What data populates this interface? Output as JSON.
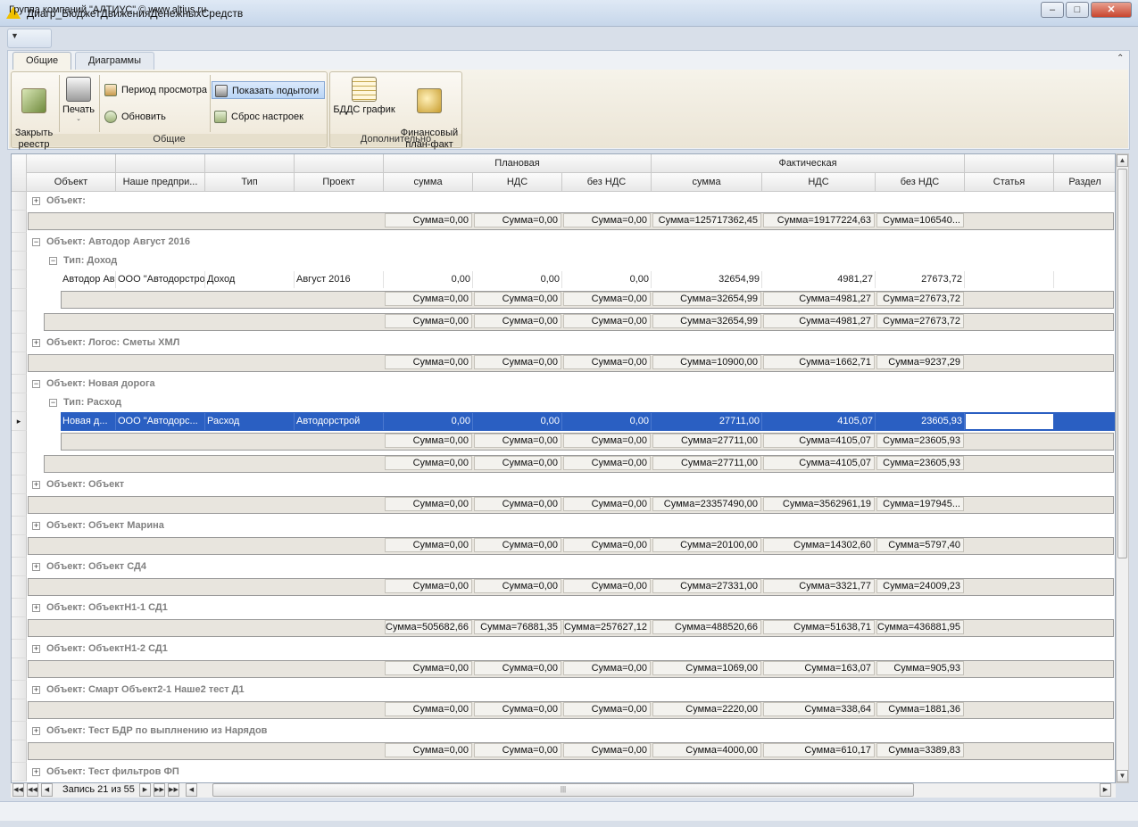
{
  "window": {
    "title": "Диагр_БюджетДвиженияДенежныхСредств"
  },
  "ribbon": {
    "tabs": [
      "Общие",
      "Диаграммы"
    ],
    "groups": {
      "general": {
        "label": "Общие",
        "close": "Закрыть\nреестр",
        "print": "Печать",
        "period": "Период просмотра",
        "refresh": "Обновить",
        "subtotals": "Показать подытоги",
        "reset": "Сброс настроек"
      },
      "extra": {
        "label": "Дополнительно",
        "bdds": "БДДС график",
        "finplan": "Финансовый\nплан-факт"
      }
    }
  },
  "grid": {
    "bands": {
      "planned": "Плановая",
      "actual": "Фактическая"
    },
    "columns": [
      "Объект",
      "Наше предпри...",
      "Тип",
      "Проект",
      "сумма",
      "НДС",
      "без НДС",
      "сумма",
      "НДС",
      "без НДС",
      "Статья",
      "Раздел"
    ],
    "rows": [
      {
        "kind": "group",
        "level": 0,
        "expanded": false,
        "text": "Объект:"
      },
      {
        "kind": "sum",
        "level": 0,
        "values": [
          "Сумма=0,00",
          "Сумма=0,00",
          "Сумма=0,00",
          "Сумма=125717362,45",
          "Сумма=19177224,63",
          "Сумма=106540..."
        ]
      },
      {
        "kind": "group",
        "level": 0,
        "expanded": true,
        "text": "Объект: Автодор Август 2016"
      },
      {
        "kind": "group",
        "level": 1,
        "expanded": true,
        "text": "Тип: Доход"
      },
      {
        "kind": "data",
        "selected": false,
        "cells": [
          "Автодор Ав",
          "ООО \"Автодорстро",
          "Доход",
          "Август 2016",
          "0,00",
          "0,00",
          "0,00",
          "32654,99",
          "4981,27",
          "27673,72",
          "",
          ""
        ]
      },
      {
        "kind": "sum",
        "level": 2,
        "values": [
          "Сумма=0,00",
          "Сумма=0,00",
          "Сумма=0,00",
          "Сумма=32654,99",
          "Сумма=4981,27",
          "Сумма=27673,72"
        ]
      },
      {
        "kind": "sum",
        "level": 1,
        "values": [
          "Сумма=0,00",
          "Сумма=0,00",
          "Сумма=0,00",
          "Сумма=32654,99",
          "Сумма=4981,27",
          "Сумма=27673,72"
        ]
      },
      {
        "kind": "group",
        "level": 0,
        "expanded": false,
        "text": "Объект: Логос: Сметы ХМЛ"
      },
      {
        "kind": "sum",
        "level": 0,
        "values": [
          "Сумма=0,00",
          "Сумма=0,00",
          "Сумма=0,00",
          "Сумма=10900,00",
          "Сумма=1662,71",
          "Сумма=9237,29"
        ]
      },
      {
        "kind": "group",
        "level": 0,
        "expanded": true,
        "text": "Объект: Новая дорога"
      },
      {
        "kind": "group",
        "level": 1,
        "expanded": true,
        "text": "Тип: Расход"
      },
      {
        "kind": "data",
        "selected": true,
        "cells": [
          "Новая д...",
          "ООО \"Автодорс...",
          "Расход",
          "Автодорстрой",
          "0,00",
          "0,00",
          "0,00",
          "27711,00",
          "4105,07",
          "23605,93",
          "",
          ""
        ]
      },
      {
        "kind": "sum",
        "level": 2,
        "values": [
          "Сумма=0,00",
          "Сумма=0,00",
          "Сумма=0,00",
          "Сумма=27711,00",
          "Сумма=4105,07",
          "Сумма=23605,93"
        ]
      },
      {
        "kind": "sum",
        "level": 1,
        "values": [
          "Сумма=0,00",
          "Сумма=0,00",
          "Сумма=0,00",
          "Сумма=27711,00",
          "Сумма=4105,07",
          "Сумма=23605,93"
        ]
      },
      {
        "kind": "group",
        "level": 0,
        "expanded": false,
        "text": "Объект: Объект"
      },
      {
        "kind": "sum",
        "level": 0,
        "values": [
          "Сумма=0,00",
          "Сумма=0,00",
          "Сумма=0,00",
          "Сумма=23357490,00",
          "Сумма=3562961,19",
          "Сумма=197945..."
        ]
      },
      {
        "kind": "group",
        "level": 0,
        "expanded": false,
        "text": "Объект: Объект Марина"
      },
      {
        "kind": "sum",
        "level": 0,
        "values": [
          "Сумма=0,00",
          "Сумма=0,00",
          "Сумма=0,00",
          "Сумма=20100,00",
          "Сумма=14302,60",
          "Сумма=5797,40"
        ]
      },
      {
        "kind": "group",
        "level": 0,
        "expanded": false,
        "text": "Объект: Объект СД4"
      },
      {
        "kind": "sum",
        "level": 0,
        "values": [
          "Сумма=0,00",
          "Сумма=0,00",
          "Сумма=0,00",
          "Сумма=27331,00",
          "Сумма=3321,77",
          "Сумма=24009,23"
        ]
      },
      {
        "kind": "group",
        "level": 0,
        "expanded": false,
        "text": "Объект: ОбъектН1-1 СД1"
      },
      {
        "kind": "sum",
        "level": 0,
        "values": [
          "Сумма=505682,66",
          "Сумма=76881,35",
          "Сумма=257627,12",
          "Сумма=488520,66",
          "Сумма=51638,71",
          "Сумма=436881,95"
        ]
      },
      {
        "kind": "group",
        "level": 0,
        "expanded": false,
        "text": "Объект: ОбъектН1-2 СД1"
      },
      {
        "kind": "sum",
        "level": 0,
        "values": [
          "Сумма=0,00",
          "Сумма=0,00",
          "Сумма=0,00",
          "Сумма=1069,00",
          "Сумма=163,07",
          "Сумма=905,93"
        ]
      },
      {
        "kind": "group",
        "level": 0,
        "expanded": false,
        "text": "Объект: Смарт Объект2-1 Наше2 тест Д1"
      },
      {
        "kind": "sum",
        "level": 0,
        "values": [
          "Сумма=0,00",
          "Сумма=0,00",
          "Сумма=0,00",
          "Сумма=2220,00",
          "Сумма=338,64",
          "Сумма=1881,36"
        ]
      },
      {
        "kind": "group",
        "level": 0,
        "expanded": false,
        "text": "Объект: Тест БДР по выплнению из Нарядов"
      },
      {
        "kind": "sum",
        "level": 0,
        "values": [
          "Сумма=0,00",
          "Сумма=0,00",
          "Сумма=0,00",
          "Сумма=4000,00",
          "Сумма=610,17",
          "Сумма=3389,83"
        ]
      },
      {
        "kind": "group",
        "level": 0,
        "expanded": false,
        "text": "Объект: Тест фильтров ФП"
      }
    ]
  },
  "navigator": {
    "record_text": "Запись 21 из 55"
  },
  "status": {
    "text": "Группа компаний \"АЛТИУС\" © www.altius.ru"
  },
  "colors": {
    "selection": "#2a5fc2",
    "group_text": "#808080",
    "sum_band": "#e8e5de"
  }
}
